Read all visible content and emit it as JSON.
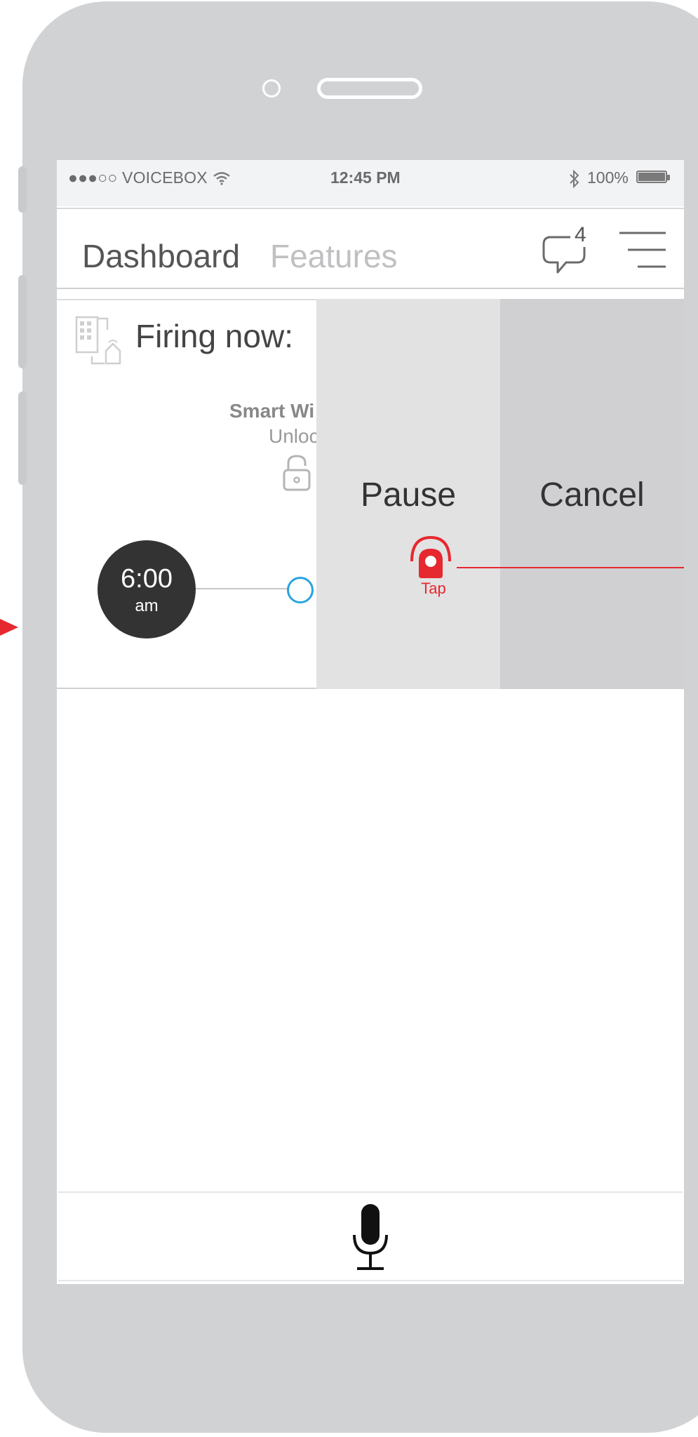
{
  "status_bar": {
    "carrier": "●●●○○ VOICEBOX",
    "time": "12:45 PM",
    "battery": "100%"
  },
  "nav": {
    "tab_dashboard": "Dashboard",
    "tab_features": "Features",
    "chat_badge_count": "4"
  },
  "card": {
    "title": "Firing now:",
    "device_name": "Smart Wi",
    "device_state": "Unloc",
    "time_main": "6:00",
    "time_sub": "am"
  },
  "actions": {
    "pause_label": "Pause",
    "cancel_label": "Cancel",
    "tap_label": "Tap"
  },
  "colors": {
    "accent_red": "#e6282f",
    "node_blue": "#27a3e0",
    "phone_gray": "#d1d2d4"
  },
  "icons": {
    "chat": "chat-bubble-icon",
    "menu": "hamburger-menu-icon",
    "building": "building-home-icon",
    "lock": "unlocked-padlock-icon",
    "tap": "tap-gesture-icon",
    "mic": "microphone-icon",
    "arrow": "arrow-right-icon"
  }
}
